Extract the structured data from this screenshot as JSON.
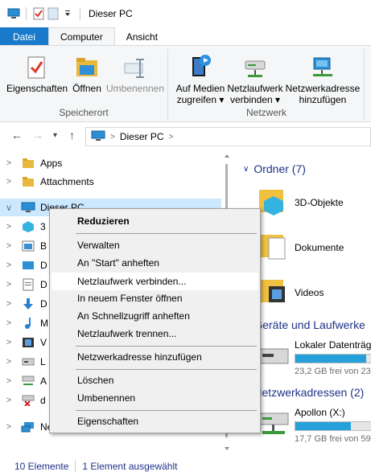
{
  "window": {
    "title": "Dieser PC"
  },
  "tabs": [
    "Datei",
    "Computer",
    "Ansicht"
  ],
  "ribbon": {
    "group_location": {
      "label": "Speicherort",
      "buttons": [
        "Eigenschaften",
        "Öffnen",
        "Umbenennen"
      ]
    },
    "group_network": {
      "label": "Netzwerk",
      "buttons": [
        {
          "line1": "Auf Medien",
          "line2": "zugreifen ▾"
        },
        {
          "line1": "Netzlaufwerk",
          "line2": "verbinden ▾"
        },
        {
          "line1": "Netzwerkadresse",
          "line2": "hinzufügen"
        }
      ]
    }
  },
  "address": {
    "path": "Dieser PC"
  },
  "nav": {
    "items": [
      "Apps",
      "Attachments",
      "Dieser PC",
      "Ne"
    ],
    "partial_letters": [
      "3",
      "B",
      "D",
      "D",
      "D",
      "M",
      "V",
      "L",
      "A",
      "d"
    ]
  },
  "content": {
    "group_folders": "Ordner (7)",
    "folders": [
      "3D-Objekte",
      "Dokumente",
      "Videos"
    ],
    "group_devices": "Geräte und Laufwerke",
    "drive_local": {
      "name": "Lokaler Datenträg",
      "free": "23,2 GB frei von 236",
      "fill": 0.9
    },
    "group_network": "Netzwerkadressen (2)",
    "drive_net": {
      "name": "Apollon (X:)",
      "free": "17,7 GB frei von 59",
      "fill": 0.7
    }
  },
  "status": {
    "count": "10 Elemente",
    "selected": "1 Element ausgewählt"
  },
  "context_menu": {
    "items": [
      "Reduzieren",
      "Verwalten",
      "An \"Start\" anheften",
      "Netzlaufwerk verbinden...",
      "In neuem Fenster öffnen",
      "An Schnellzugriff anheften",
      "Netzlaufwerk trennen...",
      "Netzwerkadresse hinzufügen",
      "Löschen",
      "Umbenennen",
      "Eigenschaften"
    ]
  },
  "colors": {
    "accent": "#1979ca",
    "selection": "#cce8ff",
    "link_text": "#1e3287"
  }
}
